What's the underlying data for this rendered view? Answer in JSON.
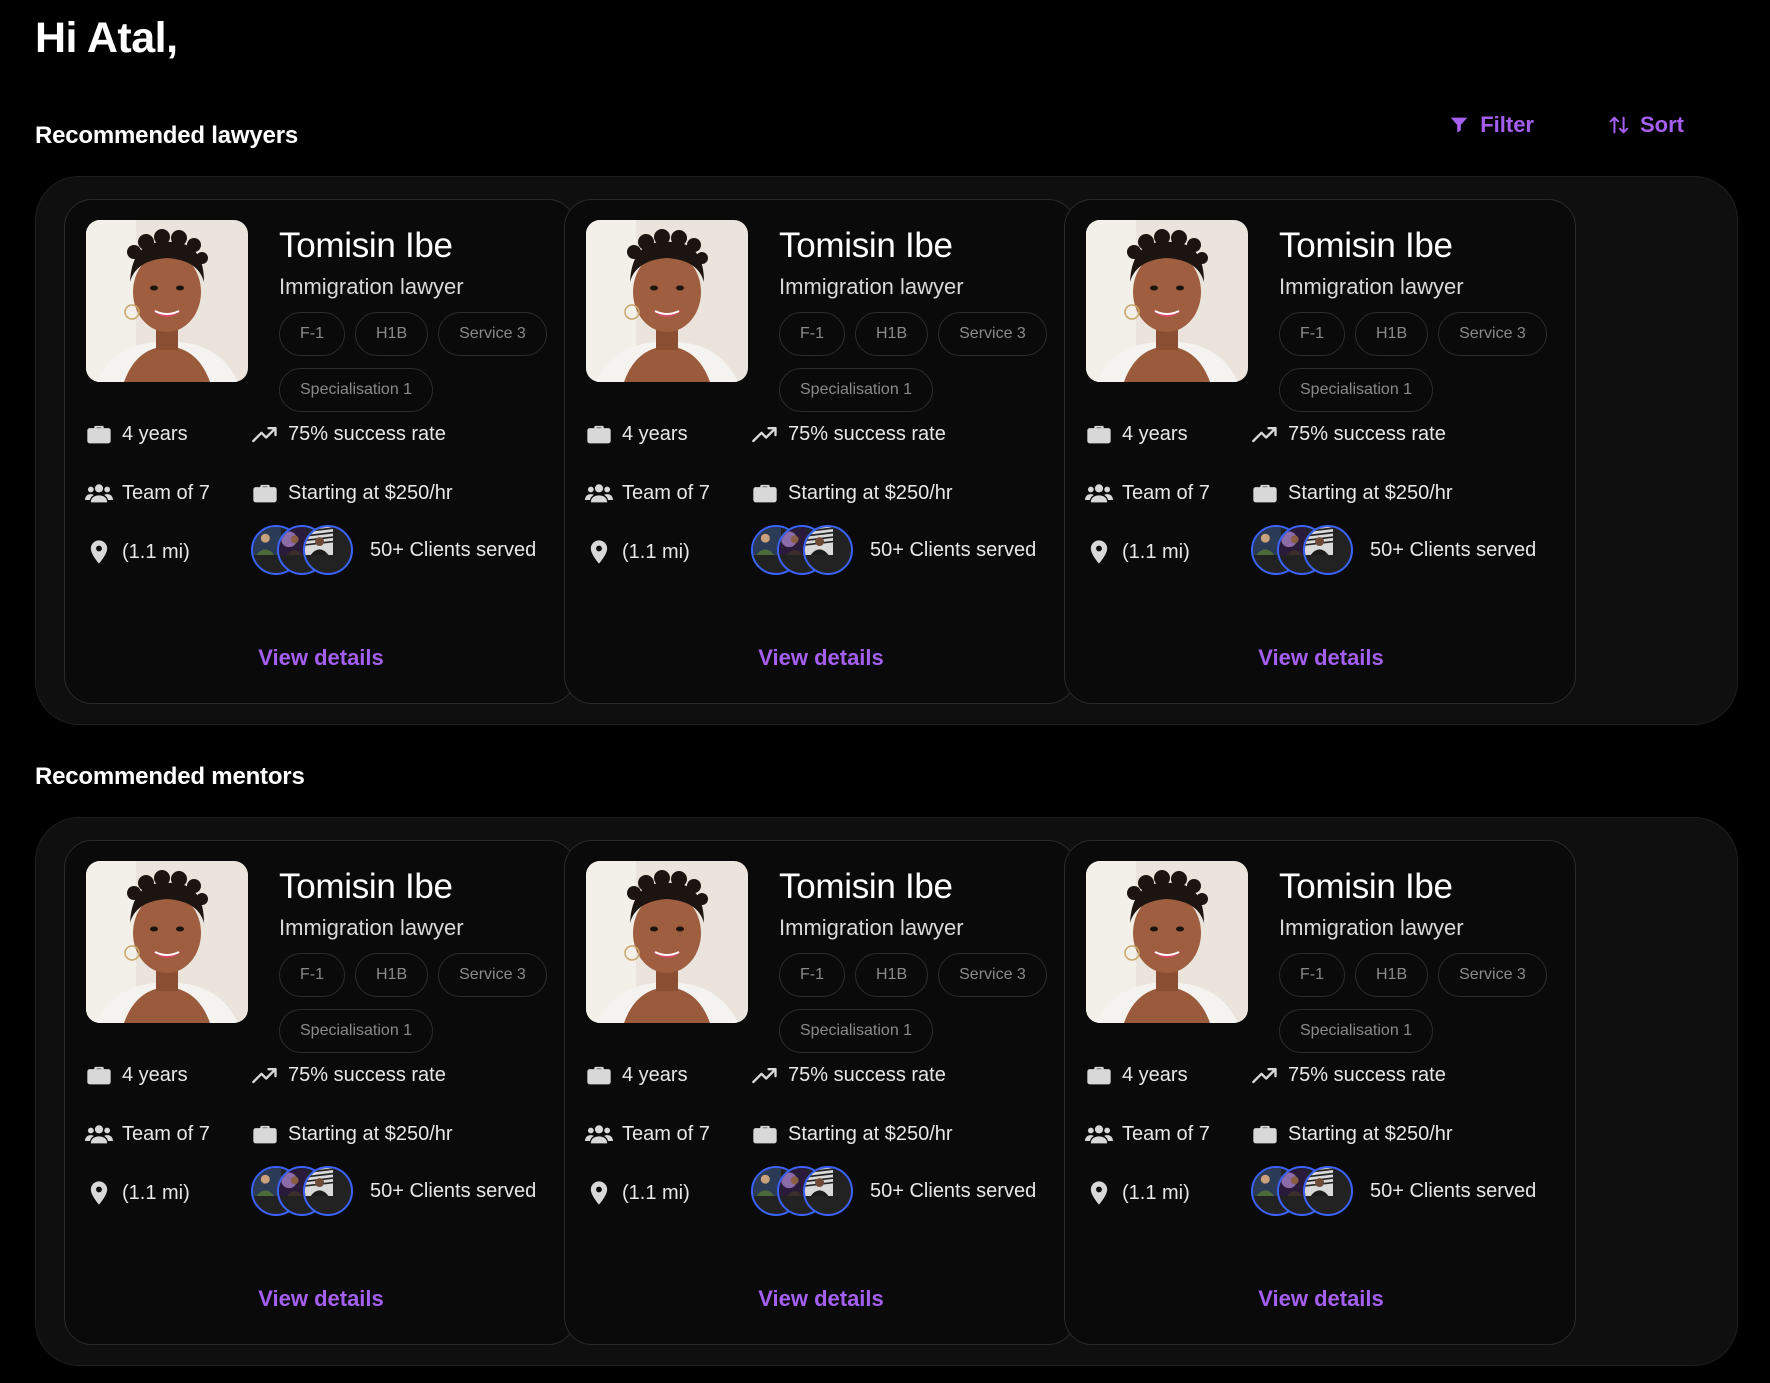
{
  "greeting": "Hi Atal,",
  "toolbar": {
    "filter_label": "Filter",
    "sort_label": "Sort"
  },
  "colors": {
    "accent": "#a55ff0",
    "avatar_ring": "#3b63ff",
    "background": "#000000"
  },
  "sections": [
    {
      "title": "Recommended lawyers",
      "cards": [
        {
          "name": "Tomisin Ibe",
          "role": "Immigration lawyer",
          "tags": [
            "F-1",
            "H1B",
            "Service 3",
            "Specialisation 1"
          ],
          "experience": "4 years",
          "success": "75% success rate",
          "team": "Team of 7",
          "price": "Starting at $250/hr",
          "distance": "(1.1 mi)",
          "clients": "50+ Clients served",
          "cta": "View details"
        },
        {
          "name": "Tomisin Ibe",
          "role": "Immigration lawyer",
          "tags": [
            "F-1",
            "H1B",
            "Service 3",
            "Specialisation 1"
          ],
          "experience": "4 years",
          "success": "75% success rate",
          "team": "Team of 7",
          "price": "Starting at $250/hr",
          "distance": "(1.1 mi)",
          "clients": "50+ Clients served",
          "cta": "View details"
        },
        {
          "name": "Tomisin Ibe",
          "role": "Immigration lawyer",
          "tags": [
            "F-1",
            "H1B",
            "Service 3",
            "Specialisation 1"
          ],
          "experience": "4 years",
          "success": "75% success rate",
          "team": "Team of 7",
          "price": "Starting at $250/hr",
          "distance": "(1.1 mi)",
          "clients": "50+ Clients served",
          "cta": "View details"
        }
      ]
    },
    {
      "title": "Recommended mentors",
      "cards": [
        {
          "name": "Tomisin Ibe",
          "role": "Immigration lawyer",
          "tags": [
            "F-1",
            "H1B",
            "Service 3",
            "Specialisation 1"
          ],
          "experience": "4 years",
          "success": "75% success rate",
          "team": "Team of 7",
          "price": "Starting at $250/hr",
          "distance": "(1.1 mi)",
          "clients": "50+ Clients served",
          "cta": "View details"
        },
        {
          "name": "Tomisin Ibe",
          "role": "Immigration lawyer",
          "tags": [
            "F-1",
            "H1B",
            "Service 3",
            "Specialisation 1"
          ],
          "experience": "4 years",
          "success": "75% success rate",
          "team": "Team of 7",
          "price": "Starting at $250/hr",
          "distance": "(1.1 mi)",
          "clients": "50+ Clients served",
          "cta": "View details"
        },
        {
          "name": "Tomisin Ibe",
          "role": "Immigration lawyer",
          "tags": [
            "F-1",
            "H1B",
            "Service 3",
            "Specialisation 1"
          ],
          "experience": "4 years",
          "success": "75% success rate",
          "team": "Team of 7",
          "price": "Starting at $250/hr",
          "distance": "(1.1 mi)",
          "clients": "50+ Clients served",
          "cta": "View details"
        }
      ]
    }
  ]
}
